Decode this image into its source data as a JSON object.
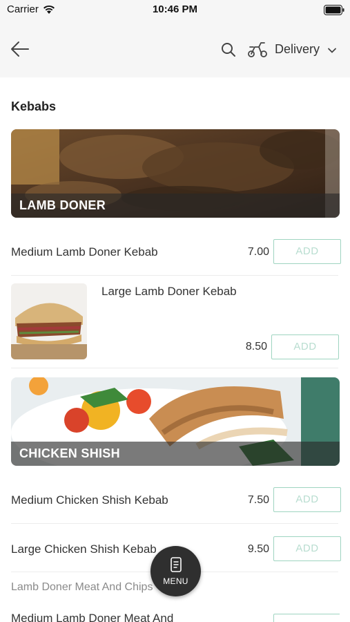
{
  "status_bar": {
    "carrier": "Carrier",
    "time": "10:46 PM"
  },
  "header": {
    "delivery_label": "Delivery"
  },
  "section": {
    "title": "Kebabs"
  },
  "categories": [
    {
      "label": "LAMB DONER"
    },
    {
      "label": "CHICKEN SHISH"
    }
  ],
  "items": [
    {
      "name": "Medium Lamb Doner Kebab",
      "price": "7.00",
      "add_label": "ADD"
    },
    {
      "name": "Large Lamb Doner Kebab",
      "price": "8.50",
      "add_label": "ADD"
    },
    {
      "name": "Medium Chicken Shish Kebab",
      "price": "7.50",
      "add_label": "ADD"
    },
    {
      "name": "Large Chicken Shish Kebab",
      "price": "9.50",
      "add_label": "ADD"
    },
    {
      "name": "Medium Lamb Doner Meat And",
      "price": "",
      "add_label": ""
    }
  ],
  "sub_heading": "Lamb Doner Meat And Chips",
  "fab": {
    "label": "MENU"
  },
  "colors": {
    "accent": "#9ed4c0",
    "header_bg": "#f6f6f6",
    "fab_bg": "#2f2f2f"
  }
}
